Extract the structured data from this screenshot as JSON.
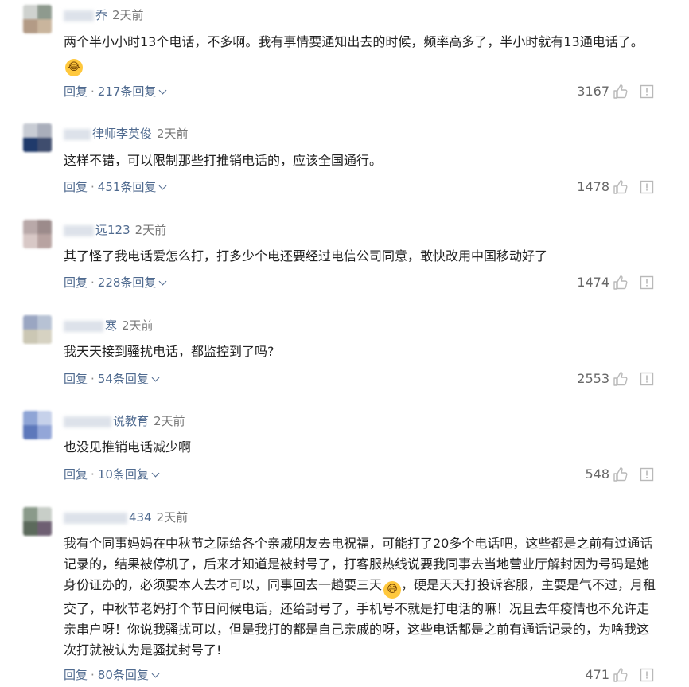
{
  "comments": [
    {
      "name_visible": "乔",
      "time": "2天前",
      "content": "两个半小小时13个电话，不多啊。我有事情要通知出去的时候，频率高多了，半小时就有13通电话了。",
      "has_emoji": true,
      "emoji_name": "laughing-emoji",
      "reply_label": "回复",
      "replies_label": "217条回复",
      "likes": "3167",
      "avatar_colors": [
        "#cfd2cf",
        "#8e9a8e",
        "#b39b86",
        "#c9b59d"
      ]
    },
    {
      "name_visible": "律师李英俊",
      "time": "2天前",
      "content": "这样不错，可以限制那些打推销电话的，应该全国通行。",
      "has_emoji": false,
      "reply_label": "回复",
      "replies_label": "451条回复",
      "likes": "1478",
      "avatar_colors": [
        "#c8ccd4",
        "#a9aebb",
        "#203a6b",
        "#3f4d6e"
      ]
    },
    {
      "name_visible": "远123",
      "time": "2天前",
      "content": "其了怪了我电话爱怎么打，打多少个电还要经过电信公司同意，敢快改用中国移动好了",
      "has_emoji": false,
      "reply_label": "回复",
      "replies_label": "228条回复",
      "likes": "1474",
      "avatar_colors": [
        "#b9a9a9",
        "#9c8b8b",
        "#d8c8c6",
        "#b8a3a1"
      ]
    },
    {
      "name_visible": "寒",
      "time": "2天前",
      "content": "我天天接到骚扰电话，都监控到了吗?",
      "has_emoji": false,
      "reply_label": "回复",
      "replies_label": "54条回复",
      "likes": "2553",
      "avatar_colors": [
        "#9aa6c2",
        "#b7c2d4",
        "#cbc7b4",
        "#d6d2c2"
      ]
    },
    {
      "name_visible": "说教育",
      "time": "2天前",
      "content": "也没见推销电话减少啊",
      "has_emoji": false,
      "reply_label": "回复",
      "replies_label": "10条回复",
      "likes": "548",
      "avatar_colors": [
        "#8fa5d6",
        "#c6d1ea",
        "#5d78bb",
        "#93a6d8"
      ]
    },
    {
      "name_visible": "434",
      "time": "2天前",
      "content": "我有个同事妈妈在中秋节之际给各个亲戚朋友去电祝福，可能打了20多个电话吧，这些都是之前有过通话记录的，结果被停机了，后来才知道是被封号了，打客服热线说要我同事去当地营业厅解封因为号码是她身份证办的，必须要本人去才可以，同事回去一趟要三天",
      "content_after_emoji": "，硬是天天打投诉客服，主要是气不过，月租交了，中秋节老妈打个节日问候电话，还给封号了，手机号不就是打电话的嘛！况且去年疫情也不允许走亲串户呀！你说我骚扰可以，但是我打的都是自己亲戚的呀，这些电话都是之前有通话记录的，为啥我这次打就被认为是骚扰封号了!",
      "has_emoji": true,
      "emoji_name": "grinning-sweat-emoji",
      "reply_label": "回复",
      "replies_label": "80条回复",
      "likes": "471",
      "avatar_colors": [
        "#8a9a8a",
        "#c8cec8",
        "#5c6a5c",
        "#6e5f72"
      ]
    }
  ],
  "icons": {
    "like": "thumbs-up-icon",
    "report": "report-icon",
    "expand": "chevron-down-icon"
  },
  "colors": {
    "link": "#4f6a8f",
    "text": "#222222",
    "meta": "#777777"
  }
}
